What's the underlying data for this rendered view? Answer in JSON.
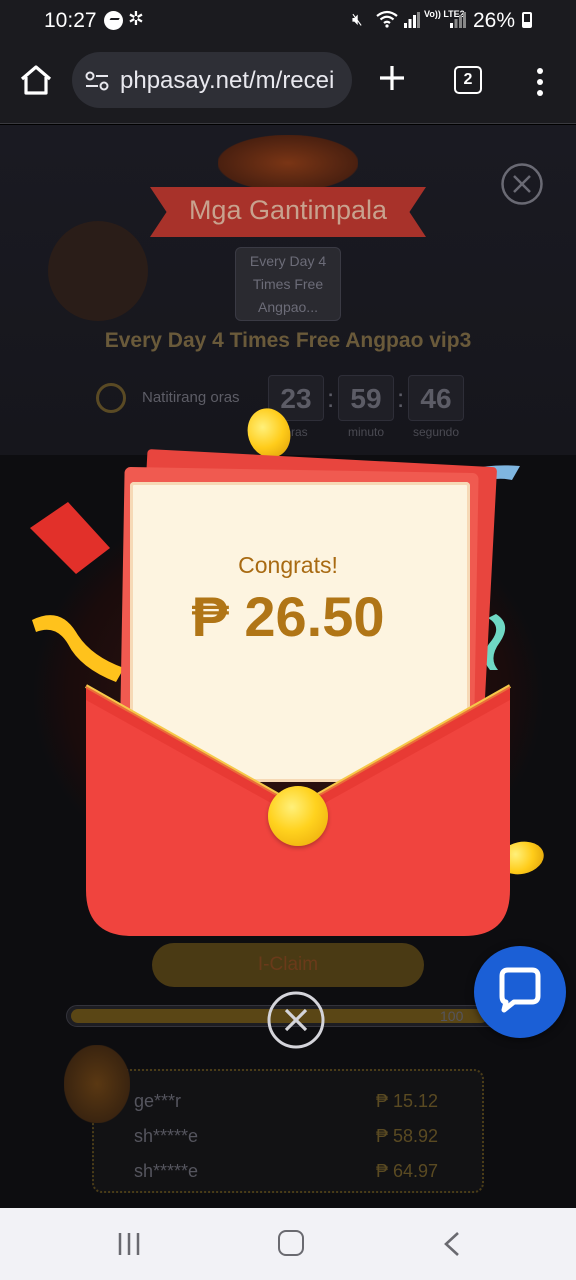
{
  "status_bar": {
    "time": "10:27",
    "battery": "26%",
    "volte": "Vo)) LTE2",
    "icons": [
      "messenger-icon",
      "settings-gear-icon",
      "mute-icon",
      "wifi-icon",
      "signal-icon",
      "battery-icon"
    ]
  },
  "browser": {
    "url": "phpasay.net/m/recei",
    "tab_count": "2"
  },
  "page": {
    "banner_title": "Mga Gantimpala",
    "reward_box": "Every Day 4 Times Free Angpao...",
    "vip_title": "Every Day 4 Times Free Angpao vip3",
    "timer_label": "Natitirang oras",
    "timer": {
      "hours": "23",
      "minutes": "59",
      "seconds": "46",
      "hours_unit": "oras",
      "minutes_unit": "minuto",
      "seconds_unit": "segundo"
    },
    "claim_label": "I-Claim",
    "progress_label": "100",
    "progress_value": 0.96,
    "winners": [
      {
        "name": "ge***r",
        "amount": "₱ 15.12"
      },
      {
        "name": "sh*****e",
        "amount": "₱ 58.92"
      },
      {
        "name": "sh*****e",
        "amount": "₱ 64.97"
      }
    ]
  },
  "popup": {
    "congrats": "Congrats!",
    "amount": "₱ 26.50"
  },
  "colors": {
    "envelope_red": "#f0443e",
    "letter_bg": "#fdf4e0",
    "amount_gold": "#b07516",
    "chat_blue": "#1b5fd6"
  }
}
